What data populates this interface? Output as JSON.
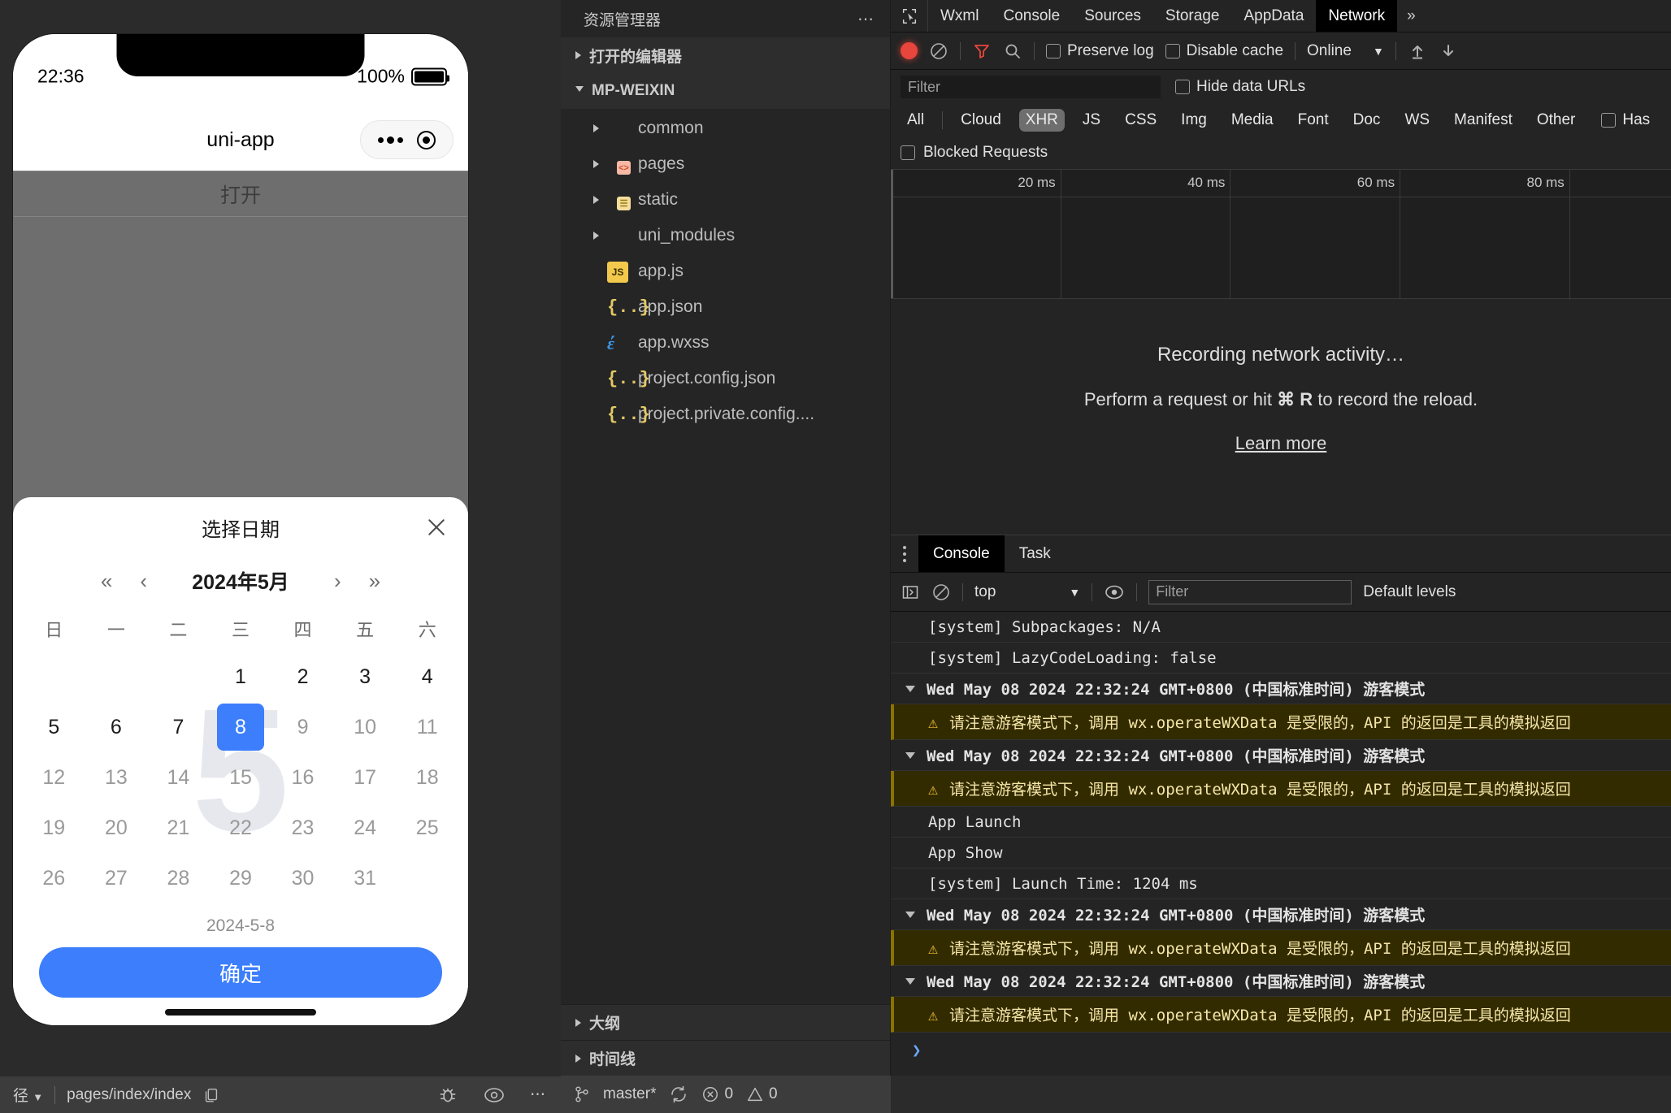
{
  "simulator": {
    "status_bar": {
      "time": "22:36",
      "battery_pct": "100%"
    },
    "navbar": {
      "title": "uni-app"
    },
    "open_button": "打开",
    "date_picker": {
      "title": "选择日期",
      "close_icon": "close-icon",
      "nav": {
        "prev_year": "«",
        "prev_month": "‹",
        "label": "2024年5月",
        "next_month": "›",
        "next_year": "»"
      },
      "weekdays": [
        "日",
        "一",
        "二",
        "三",
        "四",
        "五",
        "六"
      ],
      "watermark": "5",
      "weeks": [
        [
          {
            "d": "",
            "state": "empty"
          },
          {
            "d": "",
            "state": "empty"
          },
          {
            "d": "",
            "state": "empty"
          },
          {
            "d": "1",
            "state": "normal"
          },
          {
            "d": "2",
            "state": "normal"
          },
          {
            "d": "3",
            "state": "normal"
          },
          {
            "d": "4",
            "state": "normal"
          }
        ],
        [
          {
            "d": "5",
            "state": "normal"
          },
          {
            "d": "6",
            "state": "normal"
          },
          {
            "d": "7",
            "state": "normal"
          },
          {
            "d": "8",
            "state": "selected"
          },
          {
            "d": "9",
            "state": "muted"
          },
          {
            "d": "10",
            "state": "muted"
          },
          {
            "d": "11",
            "state": "muted"
          }
        ],
        [
          {
            "d": "12",
            "state": "muted"
          },
          {
            "d": "13",
            "state": "muted"
          },
          {
            "d": "14",
            "state": "muted"
          },
          {
            "d": "15",
            "state": "muted"
          },
          {
            "d": "16",
            "state": "muted"
          },
          {
            "d": "17",
            "state": "muted"
          },
          {
            "d": "18",
            "state": "muted"
          }
        ],
        [
          {
            "d": "19",
            "state": "muted"
          },
          {
            "d": "20",
            "state": "muted"
          },
          {
            "d": "21",
            "state": "muted"
          },
          {
            "d": "22",
            "state": "muted"
          },
          {
            "d": "23",
            "state": "muted"
          },
          {
            "d": "24",
            "state": "muted"
          },
          {
            "d": "25",
            "state": "muted"
          }
        ],
        [
          {
            "d": "26",
            "state": "muted"
          },
          {
            "d": "27",
            "state": "muted"
          },
          {
            "d": "28",
            "state": "muted"
          },
          {
            "d": "29",
            "state": "muted"
          },
          {
            "d": "30",
            "state": "muted"
          },
          {
            "d": "31",
            "state": "muted"
          },
          {
            "d": "",
            "state": "empty"
          }
        ]
      ],
      "selected_date_text": "2024-5-8",
      "confirm_label": "确定"
    }
  },
  "explorer": {
    "title": "资源管理器",
    "more_icon": "ellipsis-icon",
    "open_editors": "打开的编辑器",
    "project": "MP-WEIXIN",
    "tree": [
      {
        "label": "common",
        "icon": "folder-blue",
        "type": "folder"
      },
      {
        "label": "pages",
        "icon": "folder-orange",
        "type": "folder"
      },
      {
        "label": "static",
        "icon": "folder-yellow",
        "type": "folder"
      },
      {
        "label": "uni_modules",
        "icon": "folder-blue",
        "type": "folder"
      },
      {
        "label": "app.js",
        "icon": "js-icon",
        "type": "file"
      },
      {
        "label": "app.json",
        "icon": "json-icon",
        "type": "file"
      },
      {
        "label": "app.wxss",
        "icon": "wxss-icon",
        "type": "file"
      },
      {
        "label": "project.config.json",
        "icon": "json-icon",
        "type": "file"
      },
      {
        "label": "project.private.config....",
        "icon": "json-icon",
        "type": "file"
      }
    ],
    "outline": "大纲",
    "timeline": "时间线"
  },
  "devtools": {
    "tabs": [
      "Wxml",
      "Console",
      "Sources",
      "Storage",
      "AppData",
      "Network"
    ],
    "active_tab": "Network",
    "overflow_icon": "»",
    "cursor_icon": "inspect-cursor-icon",
    "toolbar": {
      "record_icon": "record-dot-icon",
      "clear_icon": "clear-icon",
      "filter_icon": "funnel-icon",
      "search_icon": "search-icon",
      "preserve_log": "Preserve log",
      "disable_cache": "Disable cache",
      "throttling": "Online",
      "import_icon": "upload-icon",
      "export_icon": "download-icon"
    },
    "filter": {
      "placeholder": "Filter",
      "hide_data_urls": "Hide data URLs"
    },
    "types": [
      "All",
      "Cloud",
      "XHR",
      "JS",
      "CSS",
      "Img",
      "Media",
      "Font",
      "Doc",
      "WS",
      "Manifest",
      "Other"
    ],
    "active_type": "XHR",
    "has_label": "Has",
    "blocked_requests": "Blocked Requests",
    "timeline_ticks": [
      "20 ms",
      "40 ms",
      "60 ms",
      "80 ms"
    ],
    "empty_state": {
      "line1": "Recording network activity…",
      "line2_pre": "Perform a request or hit ",
      "line2_key": "⌘ R",
      "line2_post": " to record the reload.",
      "link": "Learn more"
    },
    "console": {
      "tabs": [
        "Console",
        "Task"
      ],
      "active_tab": "Console",
      "kebab_icon": "kebab-menu-icon",
      "sidebar_icon": "show-sidebar-icon",
      "clear_icon": "clear-icon",
      "context": "top",
      "eye_icon": "eye-icon",
      "filter_placeholder": "Filter",
      "levels": "Default levels",
      "rows": [
        {
          "kind": "sys",
          "text": "[system] Subpackages: N/A"
        },
        {
          "kind": "sys",
          "text": "[system] LazyCodeLoading: false"
        },
        {
          "kind": "group",
          "text": "Wed May 08 2024 22:32:24 GMT+0800 (中国标准时间)  游客模式"
        },
        {
          "kind": "warn",
          "text": "请注意游客模式下，调用 wx.operateWXData 是受限的，API 的返回是工具的模拟返回"
        },
        {
          "kind": "group",
          "text": "Wed May 08 2024 22:32:24 GMT+0800 (中国标准时间)  游客模式"
        },
        {
          "kind": "warn",
          "text": "请注意游客模式下，调用 wx.operateWXData 是受限的，API 的返回是工具的模拟返回"
        },
        {
          "kind": "sys",
          "text": "App Launch"
        },
        {
          "kind": "sys",
          "text": "App Show"
        },
        {
          "kind": "sys",
          "text": "[system] Launch Time: 1204 ms"
        },
        {
          "kind": "group",
          "text": "Wed May 08 2024 22:32:24 GMT+0800 (中国标准时间)  游客模式"
        },
        {
          "kind": "warn",
          "text": "请注意游客模式下，调用 wx.operateWXData 是受限的，API 的返回是工具的模拟返回"
        },
        {
          "kind": "group",
          "text": "Wed May 08 2024 22:32:24 GMT+0800 (中国标准时间)  游客模式"
        },
        {
          "kind": "warn",
          "text": "请注意游客模式下，调用 wx.operateWXData 是受限的，API 的返回是工具的模拟返回"
        },
        {
          "kind": "prompt",
          "text": "❯"
        }
      ]
    }
  },
  "statusbar": {
    "path_dropdown": "径",
    "page_path": "pages/index/index",
    "copy_icon": "copy-icon",
    "debug_icon": "bug-icon",
    "eye_icon": "eye-icon",
    "more_icon": "ellipsis-icon",
    "branch": "master*",
    "sync_icon": "sync-icon",
    "errors": "0",
    "warnings": "0"
  },
  "colors": {
    "accent": "#3c7efc",
    "warn_bg": "#332b00",
    "record": "#e8453c"
  }
}
